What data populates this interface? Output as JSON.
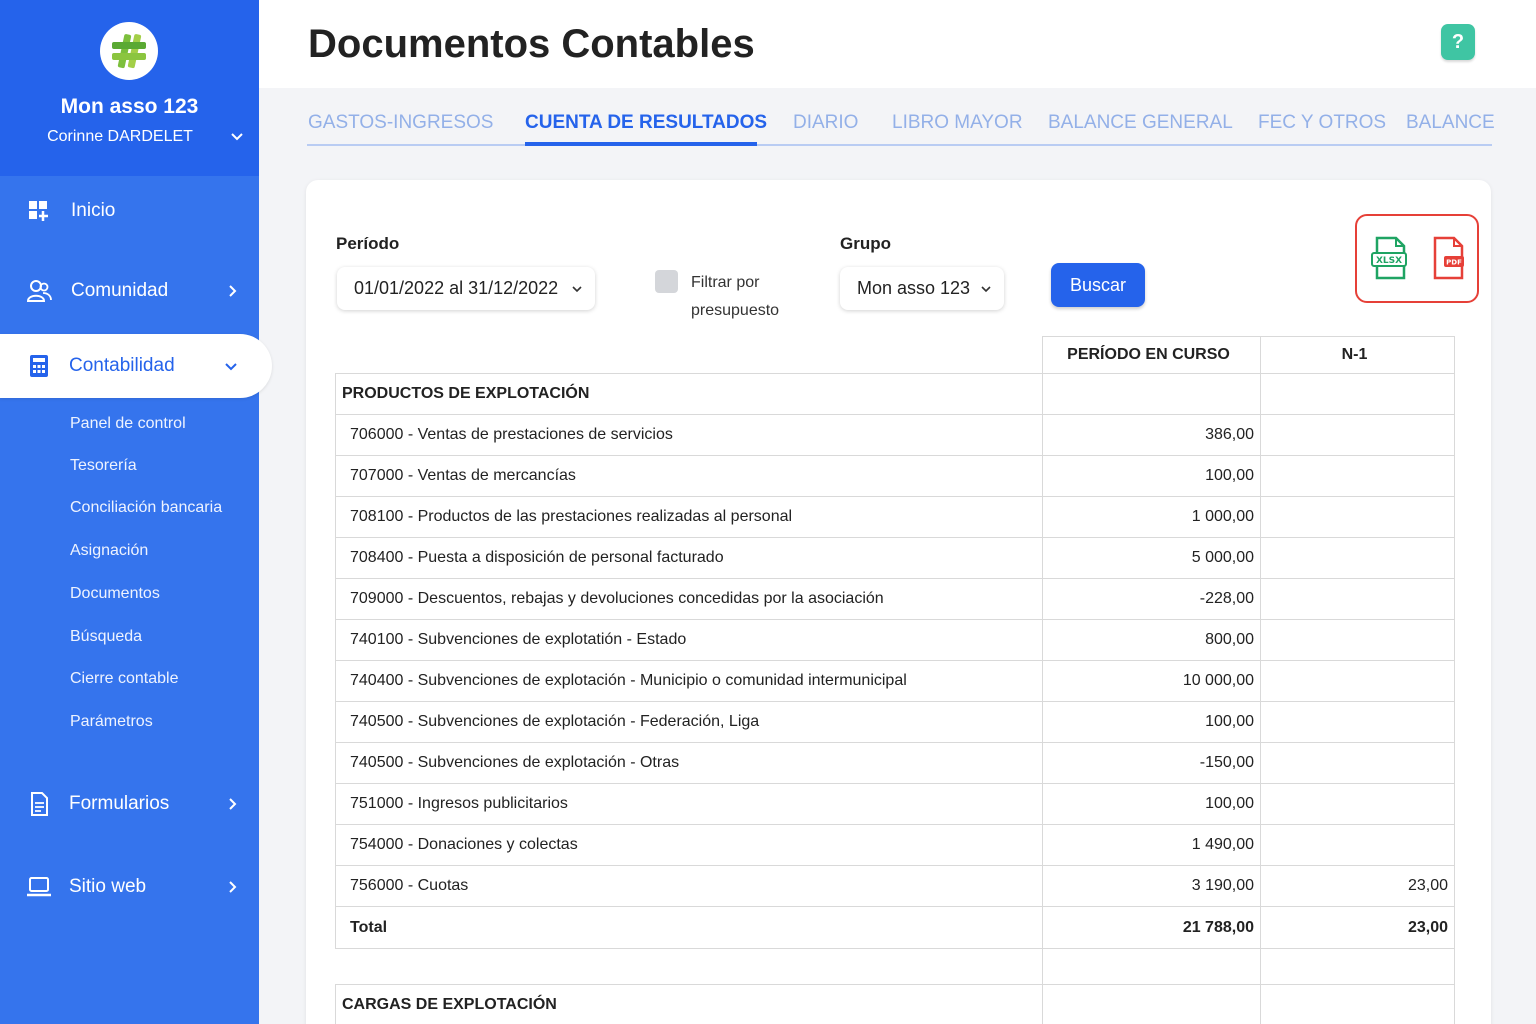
{
  "app": {
    "org_name": "Mon asso 123",
    "user_name": "Corinne DARDELET",
    "accent": "#2563eb"
  },
  "sidebar": {
    "nav": [
      {
        "label": "Inicio",
        "icon": "dashboard-icon"
      },
      {
        "label": "Comunidad",
        "icon": "users-icon"
      },
      {
        "label": "Contabilidad",
        "icon": "calculator-icon"
      },
      {
        "label": "Formularios",
        "icon": "form-icon"
      },
      {
        "label": "Sitio web",
        "icon": "laptop-icon"
      }
    ],
    "sub": [
      "Panel de control",
      "Tesorería",
      "Conciliación bancaria",
      "Asignación",
      "Documentos",
      "Búsqueda",
      "Cierre contable",
      "Parámetros"
    ]
  },
  "header": {
    "title": "Documentos Contables",
    "help": "?"
  },
  "tabs": [
    "GASTOS-INGRESOS",
    "CUENTA DE RESULTADOS",
    "DIARIO",
    "LIBRO MAYOR",
    "BALANCE GENERAL",
    "FEC Y OTROS",
    "BALANCE"
  ],
  "filters": {
    "periodo_label": "Período",
    "periodo_value": "01/01/2022 al 31/12/2022",
    "filtrar_label": "Filtrar por presupuesto",
    "grupo_label": "Grupo",
    "grupo_value": "Mon asso 123",
    "buscar": "Buscar",
    "xlsx": "XLSX",
    "pdf": "PDF"
  },
  "table": {
    "col_current": "PERÍODO EN CURSO",
    "col_prev": "N-1",
    "section1": "PRODUCTOS DE EXPLOTACIÓN",
    "rows": [
      {
        "account": "706000 - Ventas de prestaciones de servicios",
        "current": "386,00",
        "prev": ""
      },
      {
        "account": "707000 - Ventas de mercancías",
        "current": "100,00",
        "prev": ""
      },
      {
        "account": "708100 - Productos de las prestaciones realizadas al personal",
        "current": "1 000,00",
        "prev": ""
      },
      {
        "account": "708400 - Puesta a disposición de personal facturado",
        "current": "5 000,00",
        "prev": ""
      },
      {
        "account": "709000 - Descuentos, rebajas y devoluciones concedidas por la asociación",
        "current": "-228,00",
        "prev": ""
      },
      {
        "account": "740100 - Subvenciones de explotatión - Estado",
        "current": "800,00",
        "prev": ""
      },
      {
        "account": "740400 - Subvenciones de explotación - Municipio o comunidad intermunicipal",
        "current": "10 000,00",
        "prev": ""
      },
      {
        "account": "740500 - Subvenciones de explotación - Federación, Liga",
        "current": "100,00",
        "prev": ""
      },
      {
        "account": "740500 - Subvenciones de explotación - Otras",
        "current": "-150,00",
        "prev": ""
      },
      {
        "account": "751000 - Ingresos publicitarios",
        "current": "100,00",
        "prev": ""
      },
      {
        "account": "754000 - Donaciones y colectas",
        "current": "1 490,00",
        "prev": ""
      },
      {
        "account": "756000 - Cuotas",
        "current": "3 190,00",
        "prev": "23,00"
      }
    ],
    "total_label": "Total",
    "total_current": "21 788,00",
    "total_prev": "23,00",
    "section2": "CARGAS DE EXPLOTACIÓN"
  }
}
